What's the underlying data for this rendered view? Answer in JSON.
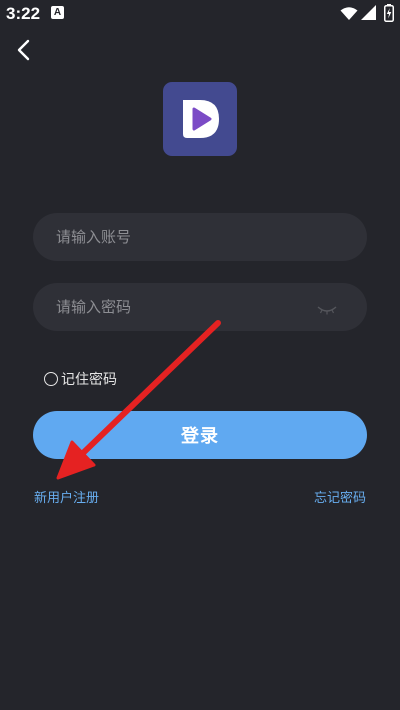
{
  "status_bar": {
    "time": "3:22",
    "notification_glyph": "A",
    "icons": [
      "wifi-icon",
      "signal-icon",
      "battery-charging-icon"
    ]
  },
  "header": {
    "back_icon": "chevron-left-icon"
  },
  "app": {
    "logo_icon": "play-logo-icon",
    "logo_color": "#434a90",
    "logo_accent": "#7b4bc6"
  },
  "login_form": {
    "account_placeholder": "请输入账号",
    "password_placeholder": "请输入密码",
    "password_toggle_icon": "eye-closed-icon",
    "remember_label": "记住密码",
    "remember_checked": false,
    "login_label": "登录",
    "register_label": "新用户注册",
    "forgot_label": "忘记密码"
  },
  "colors": {
    "background": "#24252b",
    "input_background": "#2f3037",
    "primary": "#60a9f1",
    "link": "#68aef0",
    "annotation_arrow": "#e52222"
  },
  "annotation": {
    "arrow_icon": "red-arrow-annotation"
  }
}
